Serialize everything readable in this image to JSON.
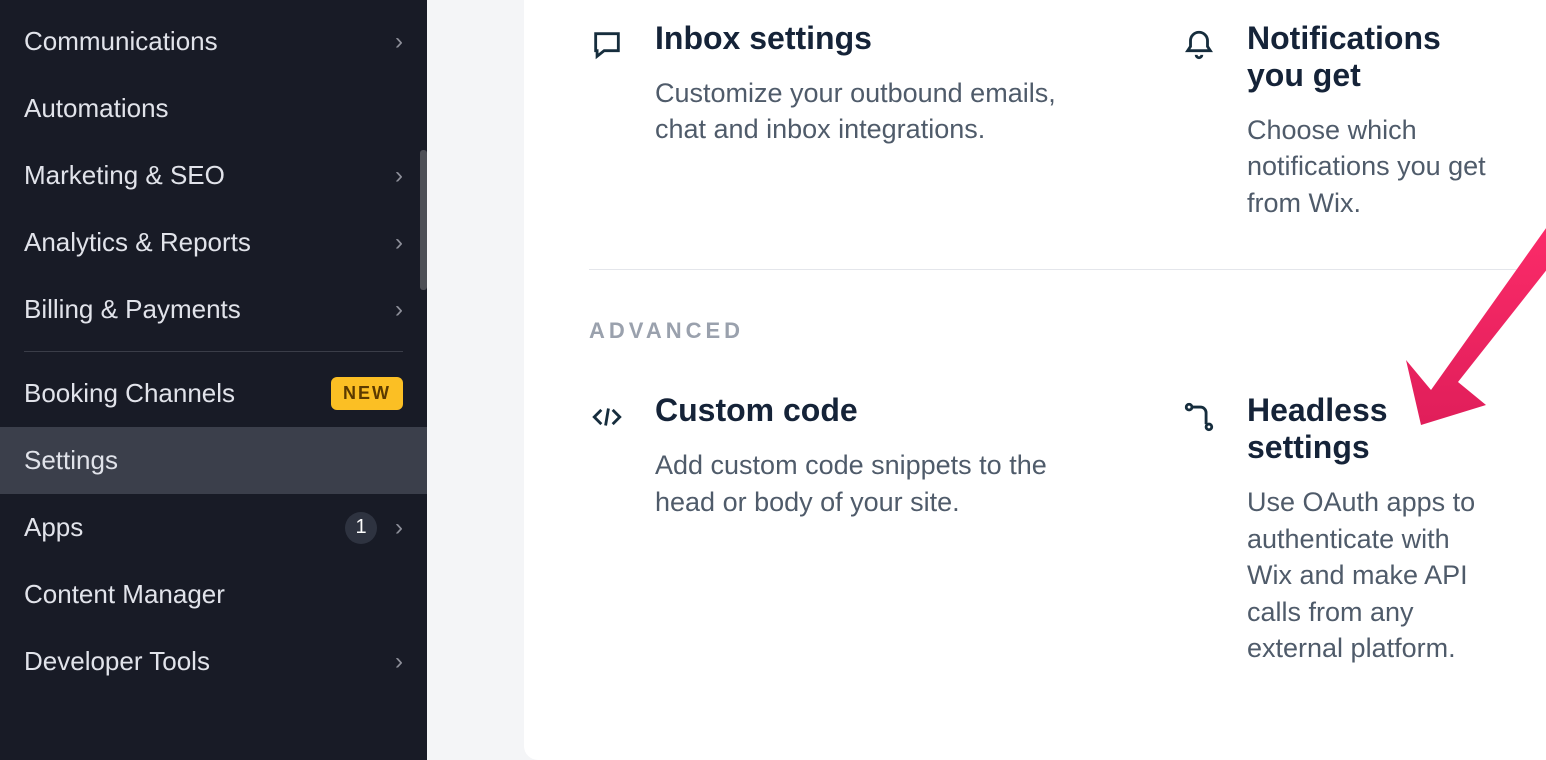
{
  "sidebar": {
    "items": [
      {
        "label": "Communications",
        "hasSub": true
      },
      {
        "label": "Automations",
        "hasSub": false
      },
      {
        "label": "Marketing & SEO",
        "hasSub": true
      },
      {
        "label": "Analytics & Reports",
        "hasSub": true
      },
      {
        "label": "Billing & Payments",
        "hasSub": true
      },
      {
        "label": "Booking Channels",
        "hasSub": false,
        "badge": "NEW"
      },
      {
        "label": "Settings",
        "hasSub": false,
        "selected": true
      },
      {
        "label": "Apps",
        "hasSub": true,
        "count": "1"
      },
      {
        "label": "Content Manager",
        "hasSub": false
      },
      {
        "label": "Developer Tools",
        "hasSub": true
      }
    ]
  },
  "main": {
    "row1": {
      "inbox": {
        "title": "Inbox settings",
        "desc": "Customize your outbound emails, chat and inbox integrations."
      },
      "notifications": {
        "title": "Notifications you get",
        "desc": "Choose which notifications you get from Wix."
      }
    },
    "section_heading": "ADVANCED",
    "row2": {
      "customcode": {
        "title": "Custom code",
        "desc": "Add custom code snippets to the head or body of your site."
      },
      "headless": {
        "title": "Headless settings",
        "desc": "Use OAuth apps to authenticate with Wix and make API calls from any external platform."
      }
    }
  }
}
